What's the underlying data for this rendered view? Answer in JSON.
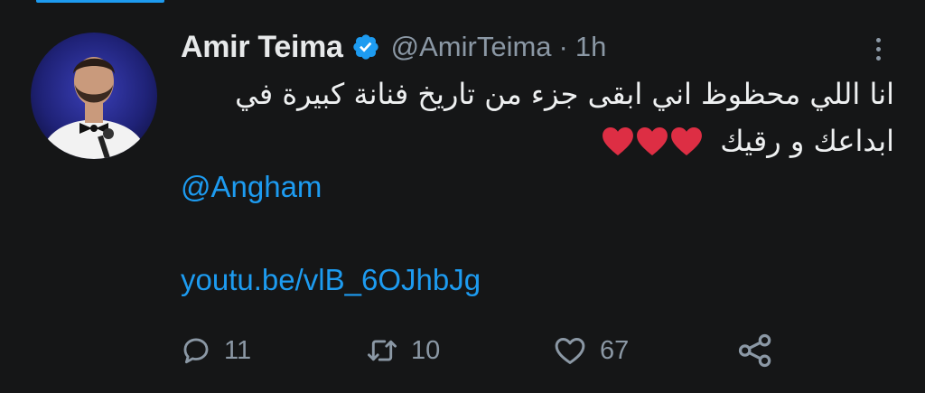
{
  "tweet": {
    "display_name": "Amir Teima",
    "verified": true,
    "handle": "@AmirTeima",
    "separator": "·",
    "time": "1h",
    "text": "انا اللي محظوظ اني ابقى جزء من تاريخ فنانة كبيرة في ابداعك و رقيك",
    "emoji": [
      "red-heart",
      "red-heart",
      "red-heart"
    ],
    "mention": "@Angham",
    "link": "youtu.be/vlB_6OJhbJg"
  },
  "actions": {
    "replies": "11",
    "retweets": "10",
    "likes": "67"
  },
  "icons": [
    "verified-badge-icon",
    "more-options-icon",
    "reply-icon",
    "retweet-icon",
    "like-icon",
    "share-icon"
  ],
  "colors": {
    "background": "#151617",
    "text": "#e7e9ea",
    "muted": "#8b98a5",
    "accent": "#1d9bf0",
    "heart": "#dd2e44"
  }
}
